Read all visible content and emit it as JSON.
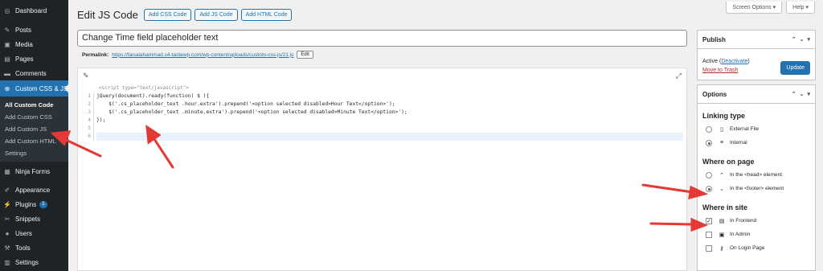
{
  "sidebar": {
    "items_top": [
      {
        "label": "Dashboard",
        "icon": "dashboard-icon",
        "glyph": "◎"
      },
      {
        "label": "Posts",
        "icon": "pin-icon",
        "glyph": "✎"
      },
      {
        "label": "Media",
        "icon": "media-icon",
        "glyph": "▣"
      },
      {
        "label": "Pages",
        "icon": "pages-icon",
        "glyph": "▤"
      },
      {
        "label": "Comments",
        "icon": "comments-icon",
        "glyph": "▬"
      }
    ],
    "active": {
      "label": "Custom CSS & JS",
      "icon": "plus-circle-icon",
      "glyph": "⊕"
    },
    "submenu": [
      "All Custom Code",
      "Add Custom CSS",
      "Add Custom JS",
      "Add Custom HTML",
      "Settings"
    ],
    "items_bottom": [
      {
        "label": "Ninja Forms",
        "icon": "forms-icon",
        "glyph": "▦"
      },
      {
        "label": "Appearance",
        "icon": "brush-icon",
        "glyph": "✐"
      },
      {
        "label": "Plugins",
        "icon": "plugin-icon",
        "glyph": "⚡",
        "badge": "1"
      },
      {
        "label": "Snippets",
        "icon": "scissors-icon",
        "glyph": "✂"
      },
      {
        "label": "Users",
        "icon": "user-icon",
        "glyph": "●"
      },
      {
        "label": "Tools",
        "icon": "wrench-icon",
        "glyph": "⚒"
      },
      {
        "label": "Settings",
        "icon": "settings-icon",
        "glyph": "▥"
      }
    ]
  },
  "header": {
    "title": "Edit JS Code",
    "buttons": [
      "Add CSS Code",
      "Add JS Code",
      "Add HTML Code"
    ],
    "screen_options": "Screen Options ▾",
    "help": "Help ▾"
  },
  "post": {
    "title_value": "Change Time field placeholder text",
    "permalink_label": "Permalink:",
    "permalink_url": "https://faisalahammad.s4-tastewp.com/wp-content/uploads/custom-css-js/21.js",
    "edit_label": "Edit"
  },
  "editor": {
    "comment": "<script type=\"text/javascript\">",
    "line_numbers": [
      "1",
      "2",
      "3",
      "4",
      "5",
      "6"
    ],
    "lines": [
      "jQuery(document).ready(function( $ ){",
      "    $('.cs_placeholder_text .hour.extra').prepend('<option selected disabled>Hour Text</option>');",
      "    $('.cs_placeholder_text .minute.extra').prepend('<option selected disabled>Minute Text</option>');",
      "});",
      "",
      ""
    ]
  },
  "publish": {
    "title": "Publish",
    "status_label": "Active",
    "deactivate": "Deactivate",
    "trash": "Move to Trash",
    "update": "Update"
  },
  "options": {
    "title": "Options",
    "linking_type": {
      "title": "Linking type",
      "items": [
        {
          "label": "External File",
          "selected": false
        },
        {
          "label": "Internal",
          "selected": true
        }
      ]
    },
    "where_on_page": {
      "title": "Where on page",
      "items": [
        {
          "label": "In the <head> element",
          "selected": false
        },
        {
          "label": "In the <footer> element",
          "selected": true
        }
      ]
    },
    "where_in_site": {
      "title": "Where in site",
      "items": [
        {
          "label": "In Frontend",
          "checked": true
        },
        {
          "label": "In Admin",
          "checked": false
        },
        {
          "label": "On Login Page",
          "checked": false
        }
      ]
    }
  },
  "colors": {
    "accent": "#2271b1",
    "sidebar_bg": "#1d2327",
    "annotation_arrow": "#e53935"
  }
}
